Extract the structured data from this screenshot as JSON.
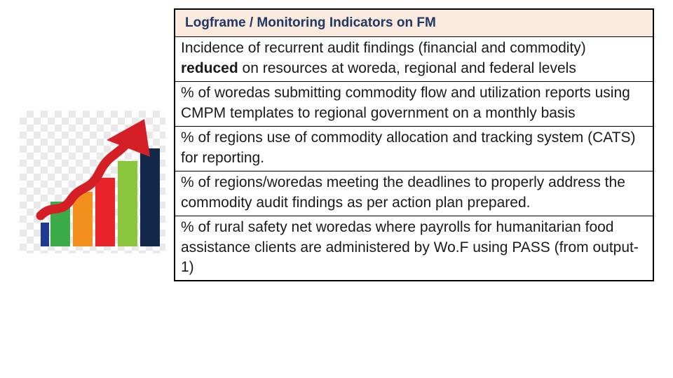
{
  "table": {
    "header": "Logframe / Monitoring Indicators on FM",
    "header_bg": "#fbeade",
    "header_color": "#1f3864",
    "rows": [
      {
        "pre": "Incidence of recurrent audit findings (financial and commodity) ",
        "bold": "reduced",
        "post": " on resources at woreda, regional and federal levels"
      },
      {
        "pre": "% of woredas submitting commodity flow and utilization reports using CMPM templates to regional government on a monthly basis",
        "bold": "",
        "post": ""
      },
      {
        "pre": "% of regions use of commodity allocation and tracking system (CATS) for reporting.",
        "bold": "",
        "post": ""
      },
      {
        "pre": "% of regions/woredas meeting the deadlines to properly address the commodity audit findings as per action plan prepared.",
        "bold": "",
        "post": ""
      },
      {
        "pre": "% of rural safety net woredas where payrolls for humanitarian food assistance clients are administered by Wo.F using PASS (from output-1)",
        "bold": "",
        "post": ""
      }
    ]
  },
  "illustration": {
    "name": "growth-bar-chart-with-arrow",
    "bar_colors": [
      "#1f3b8f",
      "#3bab4a",
      "#f3901d",
      "#e8242a",
      "#8cc63f",
      "#13294b"
    ],
    "arrow_color": "#d41f26"
  }
}
